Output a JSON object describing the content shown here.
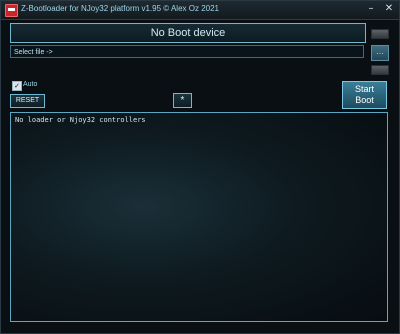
{
  "window": {
    "title": "Z-Bootloader for NJoy32 platform v1.95 © Alex Oz 2021",
    "controls": {
      "minimize": "–",
      "close": "✕"
    }
  },
  "device": {
    "status": "No Boot device"
  },
  "file": {
    "placeholder": "Select file ->",
    "browse_label": "…"
  },
  "controls": {
    "auto_label": "Auto",
    "auto_checked": true,
    "reset_label": "RESET",
    "star_label": "*",
    "start_line1": "Start",
    "start_line2": "Boot"
  },
  "log": {
    "text": "No loader or Njoy32 controllers"
  }
}
